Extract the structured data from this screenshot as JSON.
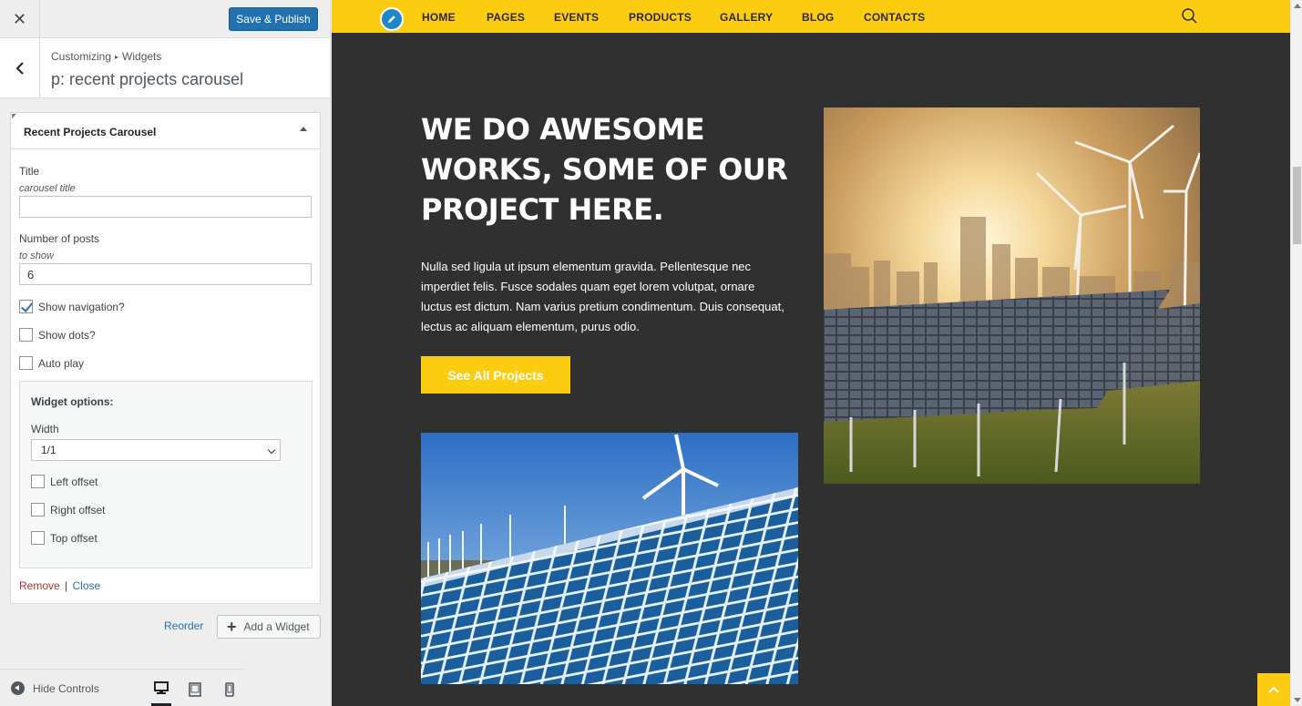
{
  "topbar": {
    "close_icon": "✕",
    "save_label": "Save & Publish"
  },
  "section": {
    "breadcrumb_root": "Customizing",
    "breadcrumb_sep": "▸",
    "breadcrumb_leaf": "Widgets",
    "title": "p: recent projects carousel"
  },
  "widget": {
    "title": "Recent Projects Carousel",
    "fields": {
      "title_label": "Title",
      "title_hint": "carousel title",
      "title_value": "",
      "posts_label": "Number of posts",
      "posts_hint": "to show",
      "posts_value": "6"
    },
    "checkboxes": [
      {
        "label": "Show navigation?",
        "checked": true
      },
      {
        "label": "Show dots?",
        "checked": false
      },
      {
        "label": "Auto play",
        "checked": false
      }
    ],
    "options": {
      "title": "Widget options:",
      "width_label": "Width",
      "width_value": "1/1",
      "checkboxes": [
        {
          "label": "Left offset",
          "checked": false
        },
        {
          "label": "Right offset",
          "checked": false
        },
        {
          "label": "Top offset",
          "checked": false
        }
      ]
    },
    "remove_label": "Remove",
    "separator": "|",
    "close_label": "Close"
  },
  "panel_actions": {
    "reorder_label": "Reorder",
    "add_widget_label": "Add a Widget",
    "add_icon": "+"
  },
  "footer": {
    "hide_controls_label": "Hide Controls"
  },
  "site": {
    "nav": [
      "HOME",
      "PAGES",
      "EVENTS",
      "PRODUCTS",
      "GALLERY",
      "BLOG",
      "CONTACTS"
    ],
    "hero_title": "WE DO AWESOME WORKS, SOME OF OUR PROJECT HERE.",
    "hero_text": "Nulla sed ligula ut ipsum elementum gravida. Pellentesque nec imperdiet felis. Fusce sodales quam eget lorem volutpat, ornare luctus est dictum. Nam varius pretium condimentum. Duis consequat, lectus ac aliquam elementum, purus odio.",
    "cta_label": "See All Projects"
  },
  "colors": {
    "accent": "#fccc10",
    "wp_blue": "#2271b1",
    "dark_bg": "#303030",
    "remove_red": "#b32d2e"
  }
}
